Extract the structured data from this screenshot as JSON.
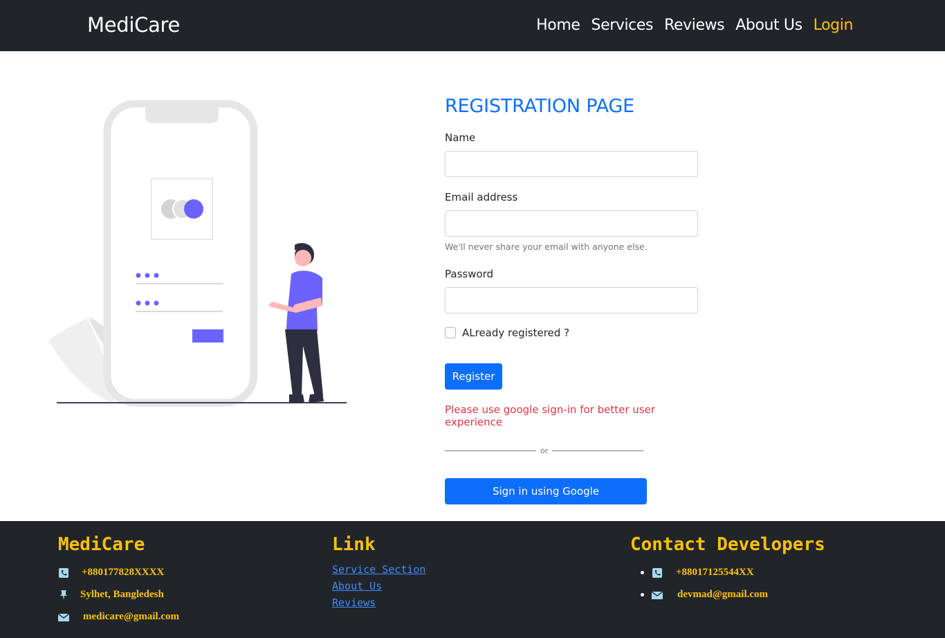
{
  "navbar": {
    "brand": "MediCare",
    "links": [
      "Home",
      "Services",
      "Reviews",
      "About Us",
      "Login"
    ]
  },
  "form": {
    "title": "REGISTRATION PAGE",
    "name_label": "Name",
    "name_value": "",
    "email_label": "Email address",
    "email_value": "",
    "email_help": "We'll never share your email with anyone else.",
    "password_label": "Password",
    "password_value": "",
    "checkbox_label": "ALready registered ?",
    "register_button": "Register",
    "google_hint": "Please use google sign-in for better user experience",
    "divider_text": "or",
    "google_button": "Sign in using Google"
  },
  "footer": {
    "brand": {
      "heading": "MediCare",
      "phone": "+880177828XXXX",
      "address": "Sylhet, Bangledesh",
      "email": "medicare@gmail.com"
    },
    "links": {
      "heading": "Link",
      "items": [
        "Service Section",
        "About Us",
        "Reviews"
      ]
    },
    "contact": {
      "heading": "Contact Developers",
      "phone": "+88017125544XX",
      "email": "devmad@gmail.com"
    }
  },
  "colors": {
    "navbar_bg": "#212529",
    "accent_yellow": "#ffc107",
    "primary_blue": "#0d6efd",
    "danger_red": "#dc3545",
    "illustration_purple": "#6c63ff"
  }
}
